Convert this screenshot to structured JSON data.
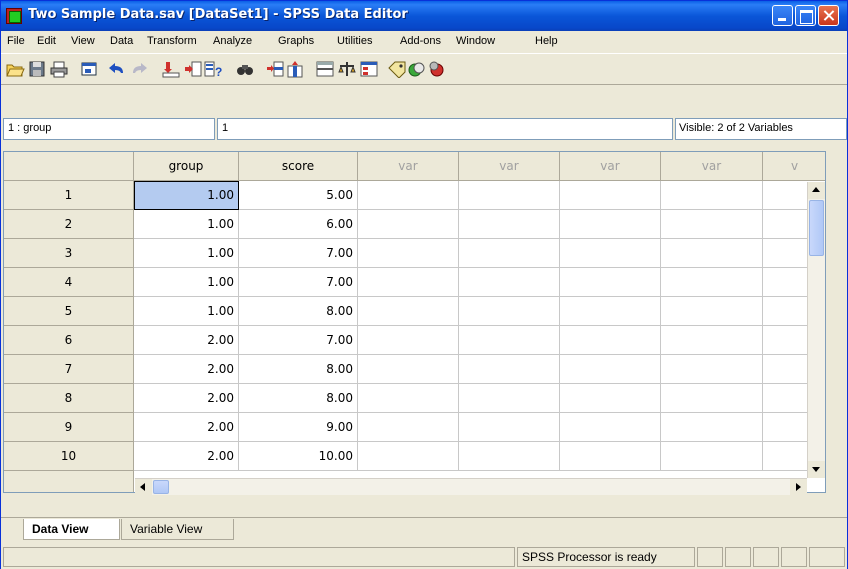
{
  "window": {
    "title": "Two Sample Data.sav [DataSet1] - SPSS Data Editor"
  },
  "menu": [
    "File",
    "Edit",
    "View",
    "Data",
    "Transform",
    "Analyze",
    "Graphs",
    "Utilities",
    "Add-ons",
    "Window",
    "Help"
  ],
  "toolbar": [
    "open-icon",
    "save-icon",
    "print-icon",
    "dialog-recall-icon",
    "undo-icon",
    "redo-icon",
    "goto-case-icon",
    "goto-variable-icon",
    "variables-icon",
    "find-icon",
    "insert-cases-icon",
    "insert-variable-icon",
    "split-file-icon",
    "weight-cases-icon",
    "select-cases-icon",
    "value-labels-icon",
    "use-sets-icon",
    "show-all-icon"
  ],
  "cell_editor": {
    "reference": "1 : group",
    "value": "1",
    "visible": "Visible: 2 of 2 Variables"
  },
  "grid": {
    "columns": [
      "group",
      "score",
      "var",
      "var",
      "var",
      "var",
      "v"
    ],
    "rows": [
      {
        "n": "1",
        "group": "1.00",
        "score": "5.00"
      },
      {
        "n": "2",
        "group": "1.00",
        "score": "6.00"
      },
      {
        "n": "3",
        "group": "1.00",
        "score": "7.00"
      },
      {
        "n": "4",
        "group": "1.00",
        "score": "7.00"
      },
      {
        "n": "5",
        "group": "1.00",
        "score": "8.00"
      },
      {
        "n": "6",
        "group": "2.00",
        "score": "7.00"
      },
      {
        "n": "7",
        "group": "2.00",
        "score": "8.00"
      },
      {
        "n": "8",
        "group": "2.00",
        "score": "8.00"
      },
      {
        "n": "9",
        "group": "2.00",
        "score": "9.00"
      },
      {
        "n": "10",
        "group": "2.00",
        "score": "10.00"
      }
    ]
  },
  "tabs": {
    "data_view": "Data View",
    "variable_view": "Variable View"
  },
  "status": {
    "processor": "SPSS  Processor is ready"
  }
}
